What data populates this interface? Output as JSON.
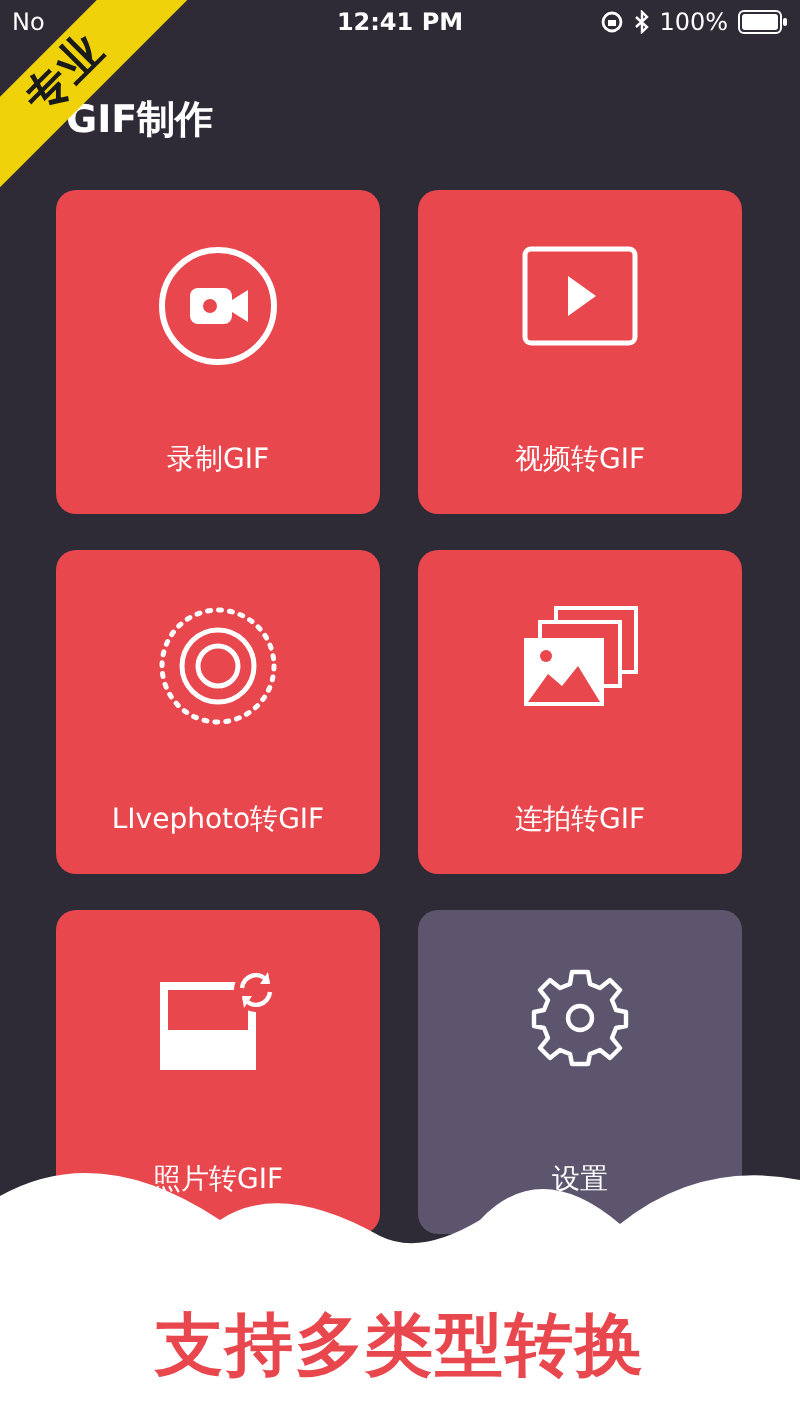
{
  "status_bar": {
    "carrier": "No",
    "time": "12:41 PM",
    "battery": "100%"
  },
  "ribbon": "专业",
  "title": "GIF制作",
  "tiles": [
    {
      "kind": "record",
      "label": "录制GIF",
      "color": "#e8474e"
    },
    {
      "kind": "video",
      "label": "视频转GIF",
      "color": "#e8474e"
    },
    {
      "kind": "live",
      "label": "LIvephoto转GIF",
      "color": "#e8474e"
    },
    {
      "kind": "burst",
      "label": "连拍转GIF",
      "color": "#e8474e"
    },
    {
      "kind": "photo",
      "label": "照片转GIF",
      "color": "#e8474e"
    },
    {
      "kind": "settings",
      "label": "设置",
      "color": "#5d546d"
    }
  ],
  "slogan": "支持多类型转换"
}
